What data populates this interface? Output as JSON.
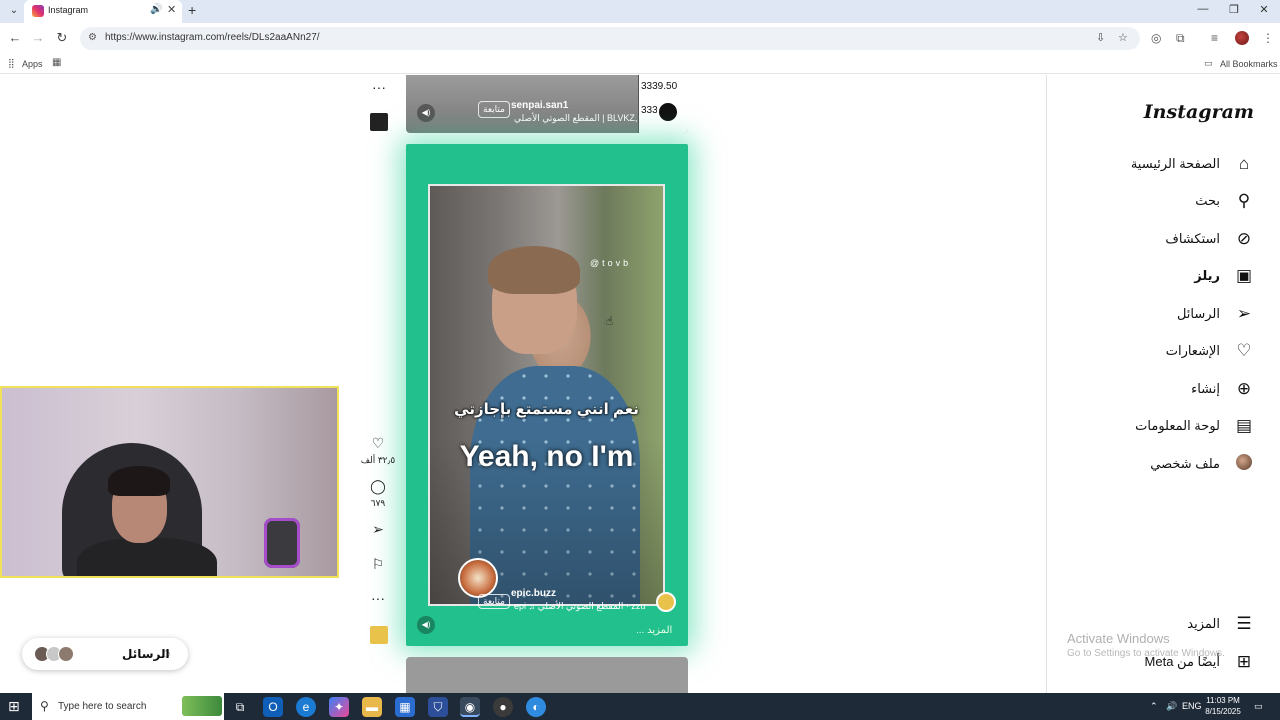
{
  "browser": {
    "tab_title": "Instagram",
    "url": "https://www.instagram.com/reels/DLs2aaANn27/",
    "bookmarks": {
      "apps": "Apps",
      "all_bookmarks": "All Bookmarks"
    },
    "icons": {
      "tab_menu": "chevron-down-icon",
      "audio": "speaker-icon",
      "close": "close-icon",
      "new_tab": "plus-icon",
      "back": "arrow-left-icon",
      "forward": "arrow-right-icon",
      "reload": "reload-icon",
      "install": "install-icon",
      "star": "star-icon",
      "extensions": "puzzle-icon",
      "media": "media-icon"
    }
  },
  "top_reel": {
    "username": "senpai.san1",
    "follow": "متابعة",
    "audio": "المقطع الصوتي الأصلي | BLVKZ, ZØ ♫",
    "counts": [
      "3339.50",
      "333"
    ]
  },
  "main_reel": {
    "watermark": "@tovb",
    "subtitle_ar": "نعم انني مستمتع بإجازتي",
    "subtitle_en": "Yeah, no I'm",
    "username": "epic.buzz",
    "follow": "متابعة",
    "audio": "epi ♫ المقطع الصوتي الأصلي · zzu",
    "more": "... المزيد"
  },
  "reel_actions": {
    "likes": "٣٢٫٥ ألف",
    "comments": "٦٧٩"
  },
  "sidebar": {
    "logo": "Instagram",
    "items": [
      {
        "label": "الصفحة الرئيسية",
        "icon": "home-icon"
      },
      {
        "label": "بحث",
        "icon": "search-icon"
      },
      {
        "label": "استكشاف",
        "icon": "compass-icon"
      },
      {
        "label": "ريلز",
        "icon": "reels-icon",
        "active": true
      },
      {
        "label": "الرسائل",
        "icon": "send-icon"
      },
      {
        "label": "الإشعارات",
        "icon": "heart-icon"
      },
      {
        "label": "إنشاء",
        "icon": "plus-square-icon"
      },
      {
        "label": "لوحة المعلومات",
        "icon": "chart-icon"
      },
      {
        "label": "ملف شخصي",
        "icon": "avatar"
      }
    ],
    "more": "المزيد",
    "meta": "أيضًا من Meta"
  },
  "activation": {
    "title": "Activate Windows",
    "subtitle": "Go to Settings to activate Windows."
  },
  "messages_pill": {
    "label": "الرسائل"
  },
  "taskbar": {
    "search_placeholder": "Type here to search",
    "lang": "ENG",
    "time": "11:03 PM",
    "date": "8/15/2025"
  }
}
